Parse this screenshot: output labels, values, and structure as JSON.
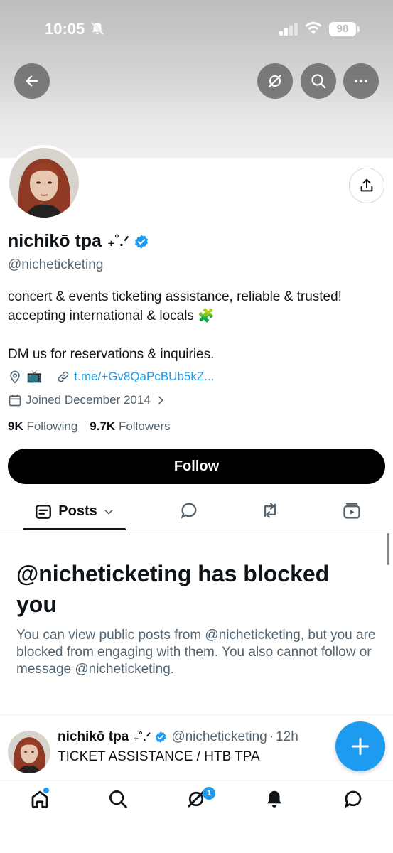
{
  "status_bar": {
    "time": "10:05",
    "battery": "98"
  },
  "profile": {
    "display_name": "nichikō tpa",
    "name_suffix": "₊˚.ᐟ",
    "handle": "@nicheticketing",
    "bio_line1": "concert & events ticketing assistance, reliable & trusted!",
    "bio_line2": "accepting international & locals 🧩",
    "bio_line3": "DM us for reservations & inquiries.",
    "location_emoji": "📺",
    "link": "t.me/+Gv8QaPcBUb5kZ...",
    "joined": "Joined December 2014",
    "following_count": "9K",
    "following_label": "Following",
    "followers_count": "9.7K",
    "followers_label": "Followers"
  },
  "follow_button": "Follow",
  "tabs": {
    "posts_label": "Posts"
  },
  "blocked": {
    "title": "@nicheticketing has blocked you",
    "text": "You can view public posts from @nicheticketing, but you are blocked from engaging with them. You also cannot follow or message @nicheticketing."
  },
  "tweet": {
    "name": "nichikō tpa",
    "name_suffix": "₊˚.ᐟ",
    "handle": "@nicheticketing",
    "separator": "·",
    "time": "12h",
    "text": "TICKET ASSISTANCE / HTB TPA"
  },
  "bottom_nav": {
    "grok_badge": "1"
  },
  "colors": {
    "accent": "#1d9bf0",
    "text": "#0f1419",
    "muted": "#536471"
  }
}
